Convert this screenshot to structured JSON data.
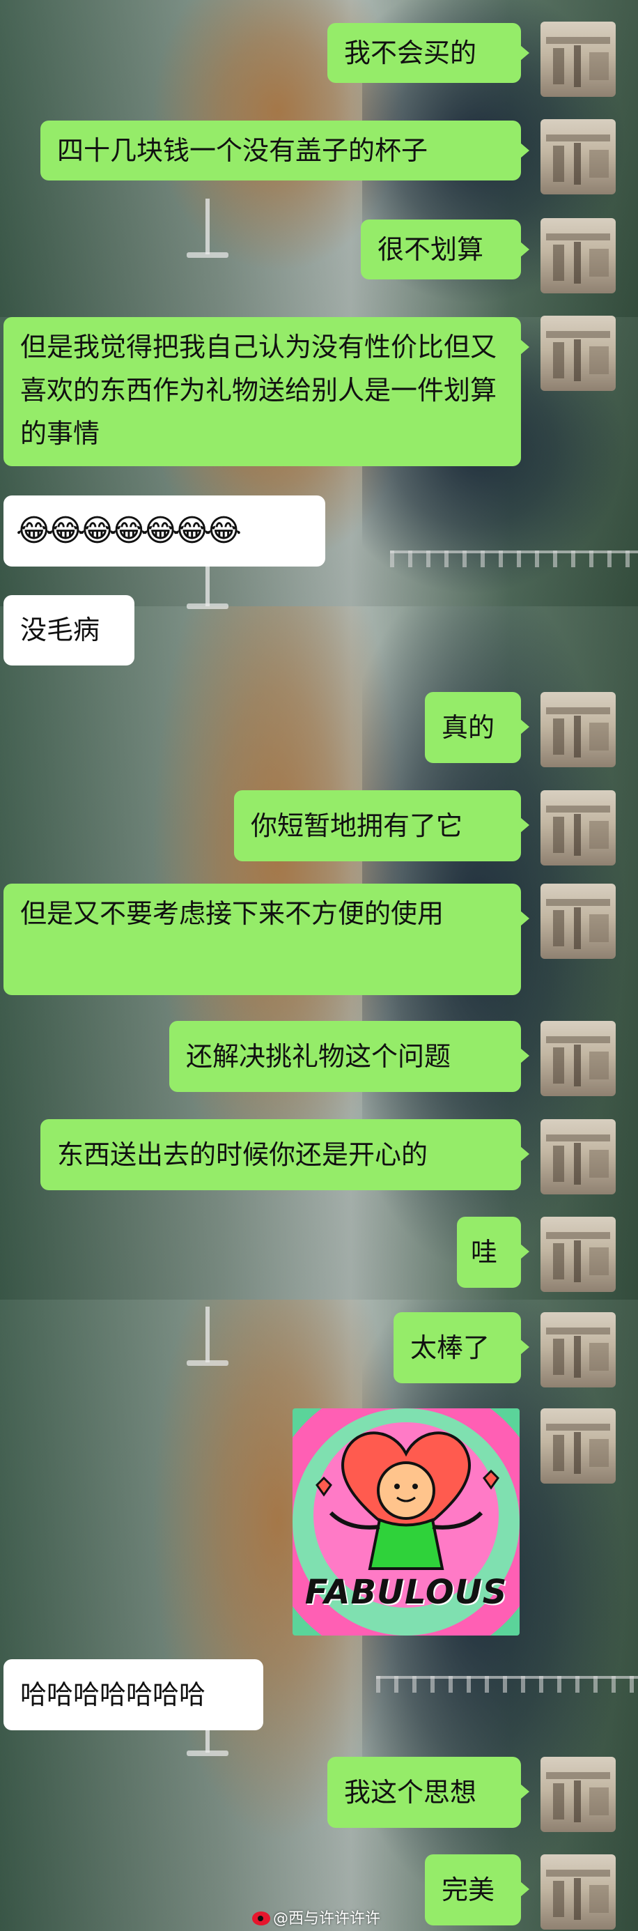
{
  "conversation": {
    "messages": [
      {
        "side": "out",
        "text": "我不会买的"
      },
      {
        "side": "out",
        "text": "四十几块钱一个没有盖子的杯子"
      },
      {
        "side": "out",
        "text": "很不划算"
      },
      {
        "side": "out",
        "text": "但是我觉得把我自己认为没有性价比但又喜欢的东西作为礼物送给别人是一件划算的事情"
      },
      {
        "side": "in",
        "text": "😂😂😂😂😂😂😂"
      },
      {
        "side": "in",
        "text": "没毛病"
      },
      {
        "side": "out",
        "text": "真的"
      },
      {
        "side": "out",
        "text": "你短暂地拥有了它"
      },
      {
        "side": "out",
        "text": "但是又不要考虑接下来不方便的使用"
      },
      {
        "side": "out",
        "text": "还解决挑礼物这个问题"
      },
      {
        "side": "out",
        "text": "东西送出去的时候你还是开心的"
      },
      {
        "side": "out",
        "text": "哇"
      },
      {
        "side": "out",
        "text": "太棒了"
      },
      {
        "side": "out",
        "type": "sticker",
        "text": "FABULOUS"
      },
      {
        "side": "in",
        "text": "哈哈哈哈哈哈哈"
      },
      {
        "side": "out",
        "text": "我这个思想"
      },
      {
        "side": "out",
        "text": "完美"
      }
    ]
  },
  "watermark": {
    "text": "@西与许许许许"
  },
  "icons": {
    "watermark_logo": "weibo-icon",
    "avatar": "user-avatar-photo",
    "sticker_art": "heart-character-sticker"
  },
  "colors": {
    "outgoing_bubble": "#95ec69",
    "incoming_bubble": "#ffffff",
    "text": "#111111"
  }
}
